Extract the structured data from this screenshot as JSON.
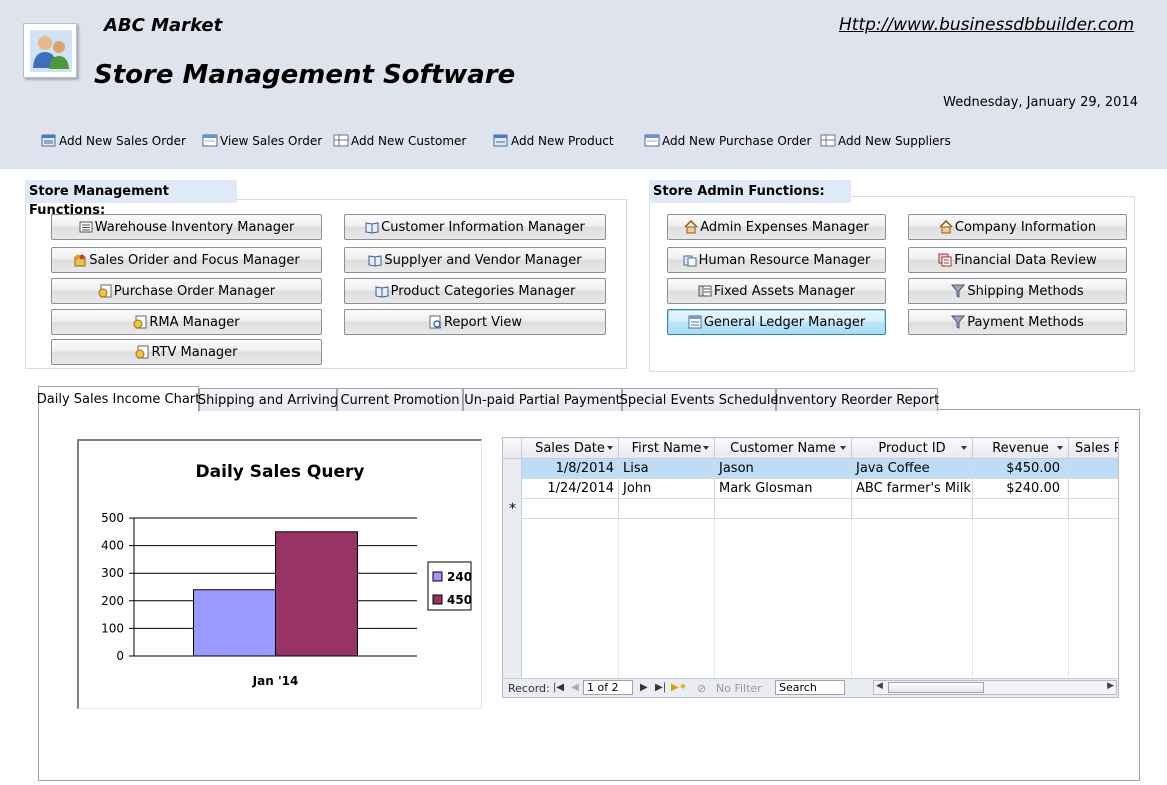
{
  "header": {
    "company": "ABC Market",
    "title": "Store Management Software",
    "website": "Http://www.businessdbbuilder.com",
    "date": "Wednesday, January 29, 2014"
  },
  "quick_links": [
    {
      "label": "Add New Sales Order",
      "icon": "add-sales-order-icon"
    },
    {
      "label": "View Sales Order",
      "icon": "view-sales-order-icon"
    },
    {
      "label": "Add New Customer",
      "icon": "add-customer-icon"
    },
    {
      "label": "Add New Product",
      "icon": "add-product-icon"
    },
    {
      "label": "Add New Purchase Order",
      "icon": "add-purchase-order-icon"
    },
    {
      "label": "Add New Suppliers",
      "icon": "add-suppliers-icon"
    }
  ],
  "store_functions": {
    "title": "Store Management Functions:",
    "buttons": [
      {
        "label": "Warehouse Inventory Manager",
        "icon": "inventory-icon"
      },
      {
        "label": "Customer Information Manager",
        "icon": "book-icon"
      },
      {
        "label": "Sales Orider and Focus Manager",
        "icon": "sales-icon"
      },
      {
        "label": "Supplyer and Vendor Manager",
        "icon": "book-icon"
      },
      {
        "label": "Purchase Order Manager",
        "icon": "order-icon"
      },
      {
        "label": "Product Categories Manager",
        "icon": "book-icon"
      },
      {
        "label": "RMA Manager",
        "icon": "order-icon"
      },
      {
        "label": "Report View",
        "icon": "report-icon"
      },
      {
        "label": "RTV Manager",
        "icon": "order-icon"
      }
    ]
  },
  "admin_functions": {
    "title": "Store Admin Functions:",
    "buttons": [
      {
        "label": "Admin Expenses Manager",
        "icon": "home-icon"
      },
      {
        "label": "Company Information",
        "icon": "home-icon"
      },
      {
        "label": "Human Resource Manager",
        "icon": "people-icon"
      },
      {
        "label": "Financial Data Review",
        "icon": "finance-icon"
      },
      {
        "label": "Fixed Assets Manager",
        "icon": "assets-icon"
      },
      {
        "label": "Shipping Methods",
        "icon": "funnel-icon"
      },
      {
        "label": "General Ledger Manager",
        "icon": "ledger-icon"
      },
      {
        "label": "Payment Methods",
        "icon": "funnel-icon"
      }
    ]
  },
  "tabs": [
    {
      "label": "Daily Sales Income Chart",
      "active": true
    },
    {
      "label": "Shipping and Arriving"
    },
    {
      "label": "Current Promotion"
    },
    {
      "label": "Un-paid Partial Payment"
    },
    {
      "label": "Special Events Schedule"
    },
    {
      "label": "Inventory Reorder Report"
    }
  ],
  "chart_data": {
    "type": "bar",
    "title": "Daily Sales Query",
    "categories": [
      "Jan '14"
    ],
    "series": [
      {
        "name": "240",
        "values": [
          240
        ],
        "color": "#9999ff"
      },
      {
        "name": "450",
        "values": [
          450
        ],
        "color": "#993366"
      }
    ],
    "yticks": [
      0,
      100,
      200,
      300,
      400,
      500
    ],
    "ylim": [
      0,
      500
    ],
    "grid": true,
    "legend": "right"
  },
  "datasheet": {
    "columns": [
      "Sales Date",
      "First Name",
      "Customer Name",
      "Product ID",
      "Revenue",
      "Sales P"
    ],
    "rows": [
      [
        "1/8/2014",
        "Lisa",
        "Jason",
        "Java Coffee",
        "$450.00"
      ],
      [
        "1/24/2014",
        "John",
        "Mark Glosman",
        "ABC farmer's Milk",
        "$240.00"
      ]
    ],
    "new_row_marker": "*",
    "nav": {
      "record_label": "Record:",
      "position": "1 of 2",
      "filter": "No Filter",
      "search": "Search"
    }
  }
}
